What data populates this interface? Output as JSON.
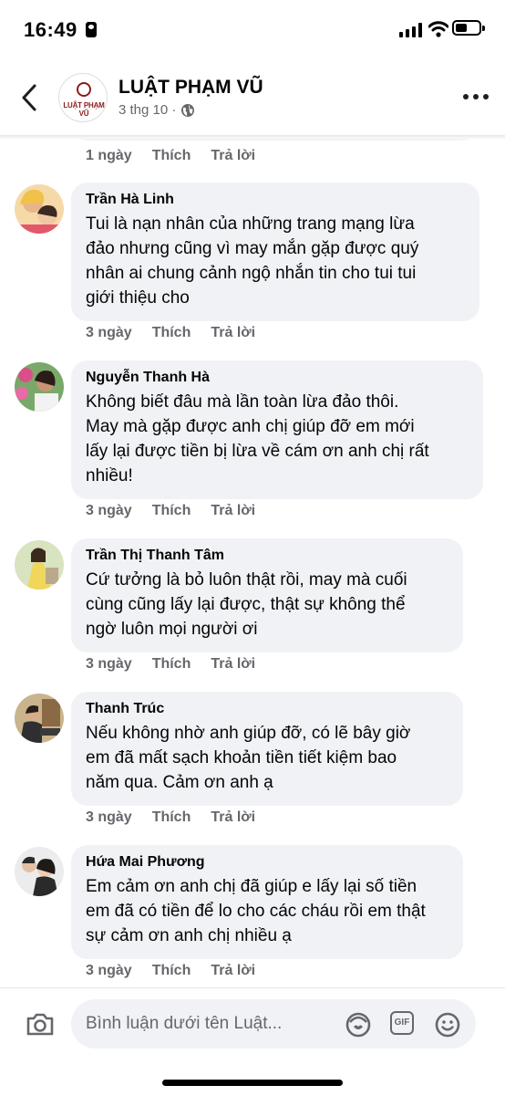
{
  "status_bar": {
    "time": "16:49"
  },
  "header": {
    "page_name": "LUẬT PHẠM VŨ",
    "date": "3 thg 10 ·",
    "avatar_text": "LUẬT PHẠM VŨ"
  },
  "previous_comment_actions": {
    "age": "1 ngày",
    "like": "Thích",
    "reply": "Trả lời"
  },
  "comments": [
    {
      "name": "Trần Hà Linh",
      "lines": [
        "Tui là nạn nhân của những trang mạng lừa",
        "đảo nhưng cũng vì may mắn gặp được quý",
        "nhân ai chung cảnh ngộ nhắn tin cho tui tui",
        "giới thiệu cho"
      ],
      "age": "3 ngày",
      "like": "Thích",
      "reply": "Trả lời"
    },
    {
      "name": "Nguyễn Thanh Hà",
      "lines": [
        "Không biết đâu mà lần toàn lừa đảo thôi.",
        "May mà gặp được anh chị giúp đỡ em mới",
        "lấy lại được tiền bị lừa về cám ơn anh chị rất",
        "nhiều!"
      ],
      "age": "3 ngày",
      "like": "Thích",
      "reply": "Trả lời"
    },
    {
      "name": "Trần Thị Thanh Tâm",
      "lines": [
        "Cứ tưởng là bỏ luôn thật rồi, may mà cuối",
        "cùng cũng lấy lại được, thật sự không thể",
        "ngờ luôn mọi người ơi"
      ],
      "age": "3 ngày",
      "like": "Thích",
      "reply": "Trả lời"
    },
    {
      "name": "Thanh Trúc",
      "lines": [
        "Nếu không nhờ anh giúp đỡ, có lẽ bây giờ",
        "em đã mất sạch khoản tiền tiết kiệm bao",
        "năm qua. Cảm ơn anh ạ"
      ],
      "age": "3 ngày",
      "like": "Thích",
      "reply": "Trả lời"
    },
    {
      "name": "Hứa Mai Phương",
      "lines": [
        "Em cảm ơn anh chị đã giúp e lấy lại số tiền",
        "em đã có tiền để lo cho các cháu rồi em thật",
        "sự cảm ơn anh chị nhiều ạ"
      ],
      "age": "3 ngày",
      "like": "Thích",
      "reply": "Trả lời"
    }
  ],
  "composer": {
    "placeholder": "Bình luận dưới tên Luật...",
    "gif_label": "GIF"
  },
  "colors": {
    "bubble": "#f0f2f5",
    "secondary_text": "#65676b",
    "brand_red": "#8b1c1c"
  },
  "icons": [
    "back-icon",
    "globe-icon",
    "more-icon",
    "camera-icon",
    "avatar-sticker-icon",
    "gif-icon",
    "emoji-icon"
  ]
}
